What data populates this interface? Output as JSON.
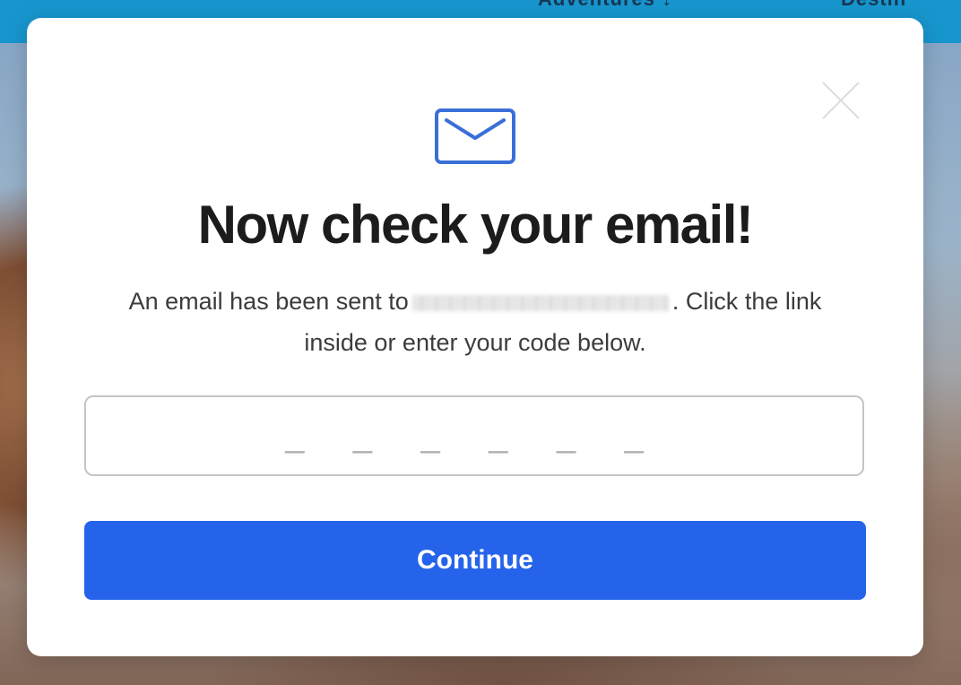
{
  "background": {
    "nav_text_left": "Adventures ↓",
    "nav_text_right": "Destin"
  },
  "modal": {
    "title": "Now check your email!",
    "description_before": "An email has been sent to",
    "description_after": ". Click the link inside or enter your code below.",
    "code_placeholder": "_ _ _ _ _ _",
    "continue_label": "Continue",
    "close_icon": "close-icon",
    "mail_icon": "envelope-icon"
  },
  "colors": {
    "accent": "#2563eb",
    "mail_icon": "#3a6fd8",
    "topbar": "#1aa3e0"
  }
}
